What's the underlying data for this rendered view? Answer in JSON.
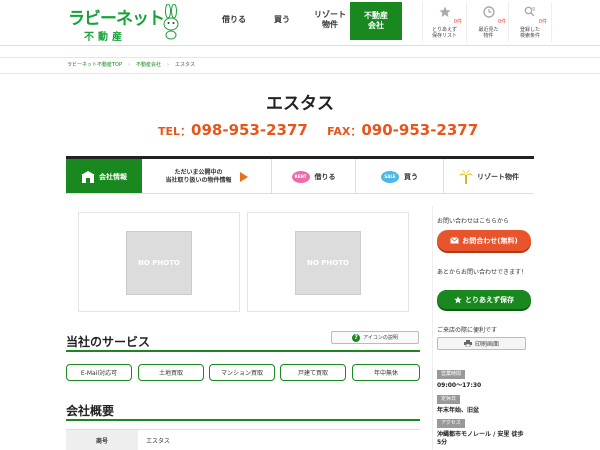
{
  "header": {
    "logo_main": "ラビーネット",
    "logo_sub": "不動産",
    "nav": [
      "借りる",
      "買う",
      "リゾート\n物件",
      "不動産\n会社"
    ],
    "icons": [
      {
        "icon": "star-icon",
        "count": "0件",
        "label": "とりあえず\n保存リスト"
      },
      {
        "icon": "clock-icon",
        "count": "0件",
        "label": "最近見た\n物件"
      },
      {
        "icon": "search-list-icon",
        "count": "0件",
        "label": "登録した\n検索条件"
      }
    ]
  },
  "breadcrumb": [
    "ラビーネット不動産TOP",
    "不動産会社",
    "エスタス"
  ],
  "company": {
    "name": "エスタス",
    "tel_label": "TEL：",
    "tel": "098-953-2377",
    "fax_label": "FAX：",
    "fax": "090-953-2377"
  },
  "tabs": [
    {
      "label": "会社情報",
      "icon": "building-icon"
    },
    {
      "label": "ただいま公開中の\n当社取り扱いの物件情報",
      "icon": "arrow-right-icon"
    },
    {
      "label": "借りる",
      "icon": "rent-badge-icon",
      "badge": "RENT"
    },
    {
      "label": "買う",
      "icon": "sale-badge-icon",
      "badge": "SALE"
    },
    {
      "label": "リゾート物件",
      "icon": "palm-tree-icon"
    }
  ],
  "photos": [
    "NO PHOTO",
    "NO PHOTO"
  ],
  "services": {
    "heading": "当社のサービス",
    "help_label": "アイコンの説明",
    "items": [
      "E-Mail対応可",
      "土地買取",
      "マンション買取",
      "戸建て買取",
      "年中無休"
    ]
  },
  "overview": {
    "heading": "会社概要",
    "rows": [
      {
        "th": "商号",
        "td": "エスタス"
      }
    ]
  },
  "sidebar": {
    "inquiry_note": "お問い合わせはこちらから",
    "inquiry_btn": "お問合わせ(無料)",
    "save_note": "あとからお問い合わせできます！",
    "save_btn": "とりあえず保存",
    "print_note": "ご来店の際に便利です",
    "print_btn": "印刷画面",
    "hours_label": "営業時間",
    "hours": "09:00～17:30",
    "holiday_label": "定休日",
    "holiday": "年末年始、旧盆",
    "access_label": "アクセス",
    "access": "沖縄都市モノレール / 安里 徒歩\n5分"
  },
  "colors": {
    "brand_green": "#19891f",
    "accent_orange": "#e8551c"
  }
}
